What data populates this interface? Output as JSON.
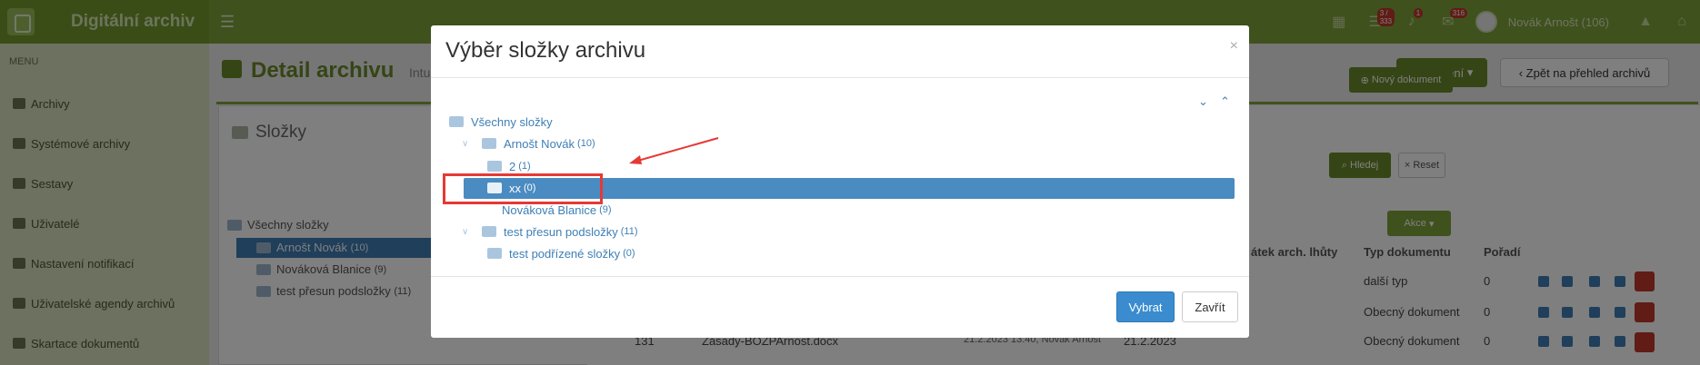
{
  "app": {
    "title": "Digitální archiv"
  },
  "topbar": {
    "badges": [
      "3 / 333",
      "1",
      "316"
    ],
    "user_name": "Novák Arnošt (106)"
  },
  "sidebar": {
    "menu_title": "MENU",
    "items": [
      {
        "label": "Archivy",
        "icon": "archive-icon"
      },
      {
        "label": "Systémové archivy",
        "icon": "server-icon"
      },
      {
        "label": "Sestavy",
        "icon": "report-icon"
      },
      {
        "label": "Uživatelé",
        "icon": "users-icon"
      },
      {
        "label": "Nastavení notifikací",
        "icon": "bell-icon"
      },
      {
        "label": "Uživatelské agendy archivů",
        "icon": "folder-open-icon"
      },
      {
        "label": "Skartace dokumentů",
        "icon": "shredder-icon"
      }
    ]
  },
  "page": {
    "title": "Detail archivu",
    "subtitle": "Intu",
    "settings_label": "Nastavení",
    "back_label": "Zpět na přehled archivů",
    "new_doc_label": "Nový dokument",
    "search_label": "Hledej",
    "reset_label": "Reset",
    "actions_label": "Akce"
  },
  "folders_panel": {
    "title": "Složky",
    "tree": [
      {
        "label": "Všechny složky",
        "count": ""
      },
      {
        "label": "Arnošt Novák",
        "count": "(10)"
      },
      {
        "label": "Nováková Blanice",
        "count": "(9)"
      },
      {
        "label": "test přesun podsložky",
        "count": "(11)"
      }
    ]
  },
  "table": {
    "headers": [
      "átek arch. lhůty",
      "Typ dokumentu",
      "Pořadí"
    ],
    "rows": [
      {
        "type": "další typ",
        "order": "0"
      },
      {
        "type": "Obecný dokument",
        "order": "0"
      },
      {
        "id": "131",
        "name": "Zásady-BOZPArnost.docx",
        "created": "21.2.2023 13:40, Novák Arnošt",
        "date": "21.2.2023",
        "type": "Obecný dokument",
        "order": "0"
      }
    ]
  },
  "modal": {
    "title": "Výběr složky archivu",
    "close_glyph": "×",
    "tree": [
      {
        "label": "Všechny složky",
        "count": ""
      },
      {
        "label": "Arnošt Novák",
        "count": "(10)"
      },
      {
        "label": "2",
        "count": "(1)"
      },
      {
        "label": "xx",
        "count": "(0)"
      },
      {
        "label": "Nováková Blanice",
        "count": "(9)"
      },
      {
        "label": "test přesun podsložky",
        "count": "(11)"
      },
      {
        "label": "test podřízené složky",
        "count": "(0)"
      }
    ],
    "select_label": "Vybrat",
    "close_label": "Zavřít"
  }
}
